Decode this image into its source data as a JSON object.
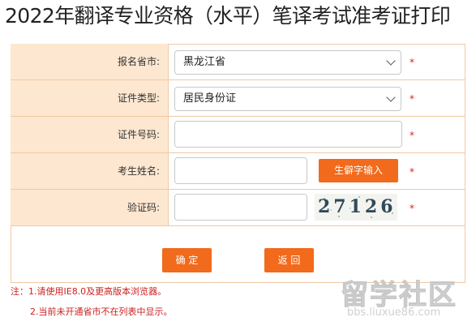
{
  "page": {
    "title": "2022年翻译专业资格（水平）笔译考试准考证打印"
  },
  "form": {
    "province": {
      "label": "报名省市:",
      "value": "黑龙江省"
    },
    "id_type": {
      "label": "证件类型:",
      "value": "居民身份证"
    },
    "id_number": {
      "label": "证件号码:",
      "value": ""
    },
    "name": {
      "label": "考生姓名:",
      "value": "",
      "rare_char_button": "生僻字输入"
    },
    "captcha": {
      "label": "验证码:",
      "value": "",
      "image_text": "27126"
    },
    "required_mark": "*"
  },
  "buttons": {
    "confirm": "确 定",
    "back": "返 回"
  },
  "notes": {
    "line1": "注：1.请使用IE8.0及更高版本浏览器。",
    "line2": "2.当前未开通省市不在列表中显示。"
  },
  "watermark": {
    "brand": "留学社区",
    "url": "bbs.liuxue86.com"
  },
  "colors": {
    "label_bg": "#fde7d0",
    "border": "#f0c9a3",
    "accent": "#f26a1b",
    "required": "#e02020"
  }
}
